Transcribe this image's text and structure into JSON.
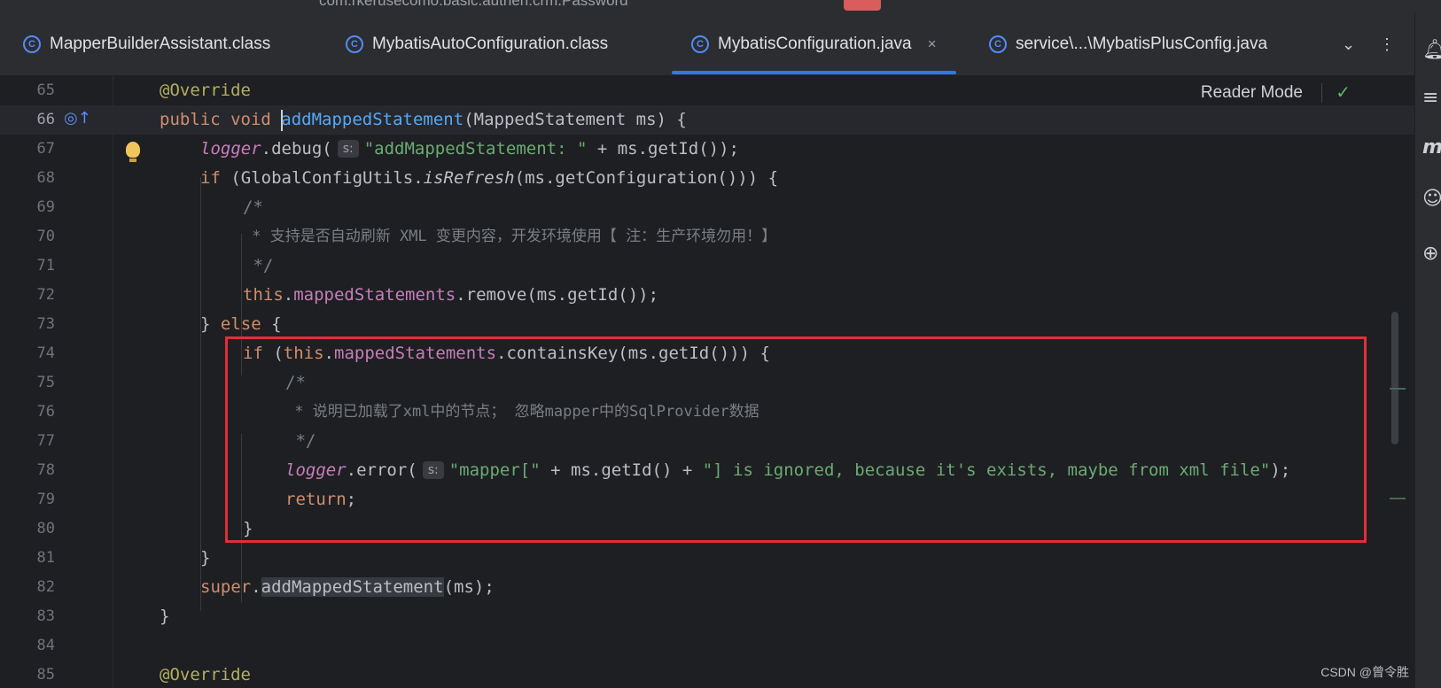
{
  "window": {
    "title_fragment": "com.rkerusecomo.basic.authen.crm.Password"
  },
  "tabs": [
    {
      "label": "MapperBuilderAssistant.class",
      "icon": "class-icon",
      "active": false
    },
    {
      "label": "MybatisAutoConfiguration.class",
      "icon": "class-icon",
      "active": false
    },
    {
      "label": "MybatisConfiguration.java",
      "icon": "class-icon",
      "active": true,
      "close": "×"
    },
    {
      "label": "service\\...\\MybatisPlusConfig.java",
      "icon": "class-icon",
      "active": false
    }
  ],
  "tab_actions": {
    "more": "⌄",
    "menu": "⋮"
  },
  "editor": {
    "reader_mode_label": "Reader Mode",
    "current_line": 66,
    "line_numbers": [
      "65",
      "66",
      "67",
      "68",
      "69",
      "70",
      "71",
      "72",
      "73",
      "74",
      "75",
      "76",
      "77",
      "78",
      "79",
      "80",
      "81",
      "82",
      "83",
      "84",
      "85"
    ],
    "param_hint": "s:",
    "code": {
      "l65": "@Override",
      "l66_kw": "public void ",
      "l66_fn": "addMappedStatement",
      "l66_rest": "(MappedStatement ms) {",
      "l67_logger": "logger",
      "l67_call": ".debug(",
      "l67_str": "\"addMappedStatement: \"",
      "l67_rest": " + ms.getId());",
      "l68_if": "if",
      "l68_a": " (GlobalConfigUtils.",
      "l68_it": "isRefresh",
      "l68_b": "(ms.getConfiguration())) {",
      "l69": "/*",
      "l70": " * 支持是否自动刷新 XML 变更内容，开发环境使用【 注：生产环境勿用！】",
      "l71": " */",
      "l72_this": "this",
      "l72_dot": ".",
      "l72_fld": "mappedStatements",
      "l72_rest": ".remove(ms.getId());",
      "l73_a": "} ",
      "l73_else": "else",
      "l73_b": " {",
      "l74_if": "if",
      "l74_a": " (",
      "l74_this": "this",
      "l74_dot": ".",
      "l74_fld": "mappedStatements",
      "l74_rest": ".containsKey(ms.getId())) {",
      "l75": "/*",
      "l76": " * 说明已加载了xml中的节点； 忽略mapper中的SqlProvider数据",
      "l77": " */",
      "l78_logger": "logger",
      "l78_call": ".error(",
      "l78_str1": "\"mapper[\"",
      "l78_mid": " + ms.getId() + ",
      "l78_str2": "\"] is ignored, because it's exists, maybe from xml file\"",
      "l78_end": ");",
      "l79": "return",
      "l79_end": ";",
      "l80": "}",
      "l81": "}",
      "l82_super": "super",
      "l82_dot": ".",
      "l82_call": "addMappedStatement",
      "l82_rest": "(ms);",
      "l83": "}",
      "l84": "",
      "l85": "@Override"
    }
  },
  "footer": {
    "watermark": "CSDN @曾令胜"
  },
  "colors": {
    "keyword": "#cf8e6d",
    "string": "#6aab73",
    "annotation": "#b3ae60",
    "field": "#c77dbb",
    "comment": "#7a7e85",
    "highlight_box": "#e02f3a",
    "active_tab_underline": "#3574f0"
  }
}
